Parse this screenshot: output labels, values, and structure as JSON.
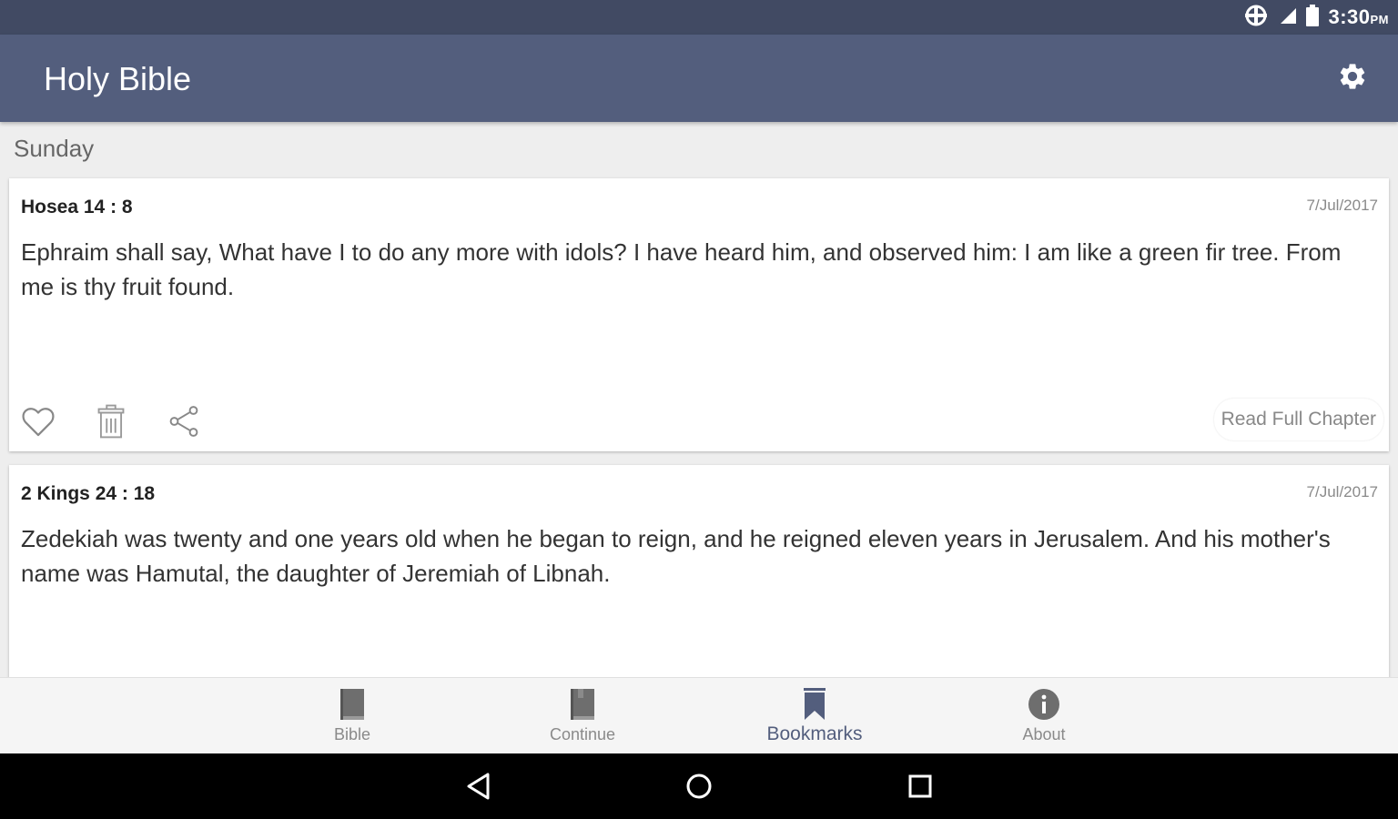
{
  "status_bar": {
    "time": "3:30",
    "ampm": "PM",
    "icons": [
      "data-saver-icon",
      "signal-icon",
      "battery-icon"
    ]
  },
  "app_bar": {
    "title": "Holy Bible",
    "settings_icon": "gear-icon"
  },
  "section": {
    "day": "Sunday"
  },
  "bookmarks": [
    {
      "book": "Hosea",
      "chapter_verse": "14 : 8",
      "date": "7/Jul/2017",
      "text": "Ephraim shall say, What have I to do any more with idols? I have heard him, and observed him: I am like a green fir tree. From me is thy fruit found.",
      "actions": [
        "heart-icon",
        "trash-icon",
        "share-icon"
      ],
      "read_full_label": "Read Full Chapter"
    },
    {
      "book": "2 Kings",
      "chapter_verse": "24 : 18",
      "date": "7/Jul/2017",
      "text": "Zedekiah was twenty and one years old when he began to reign, and he reigned eleven years in Jerusalem. And his mother's name was Hamutal, the daughter of Jeremiah of Libnah."
    }
  ],
  "bottom_nav": {
    "items": [
      {
        "label": "Bible",
        "icon": "book-icon",
        "active": false
      },
      {
        "label": "Continue",
        "icon": "book-icon",
        "active": false
      },
      {
        "label": "Bookmarks",
        "icon": "bookmark-icon",
        "active": true
      },
      {
        "label": "About",
        "icon": "info-icon",
        "active": false
      }
    ]
  },
  "colors": {
    "status_bar": "#414a63",
    "app_bar": "#535e7d",
    "accent": "#535e7d",
    "background": "#eeeeee"
  }
}
